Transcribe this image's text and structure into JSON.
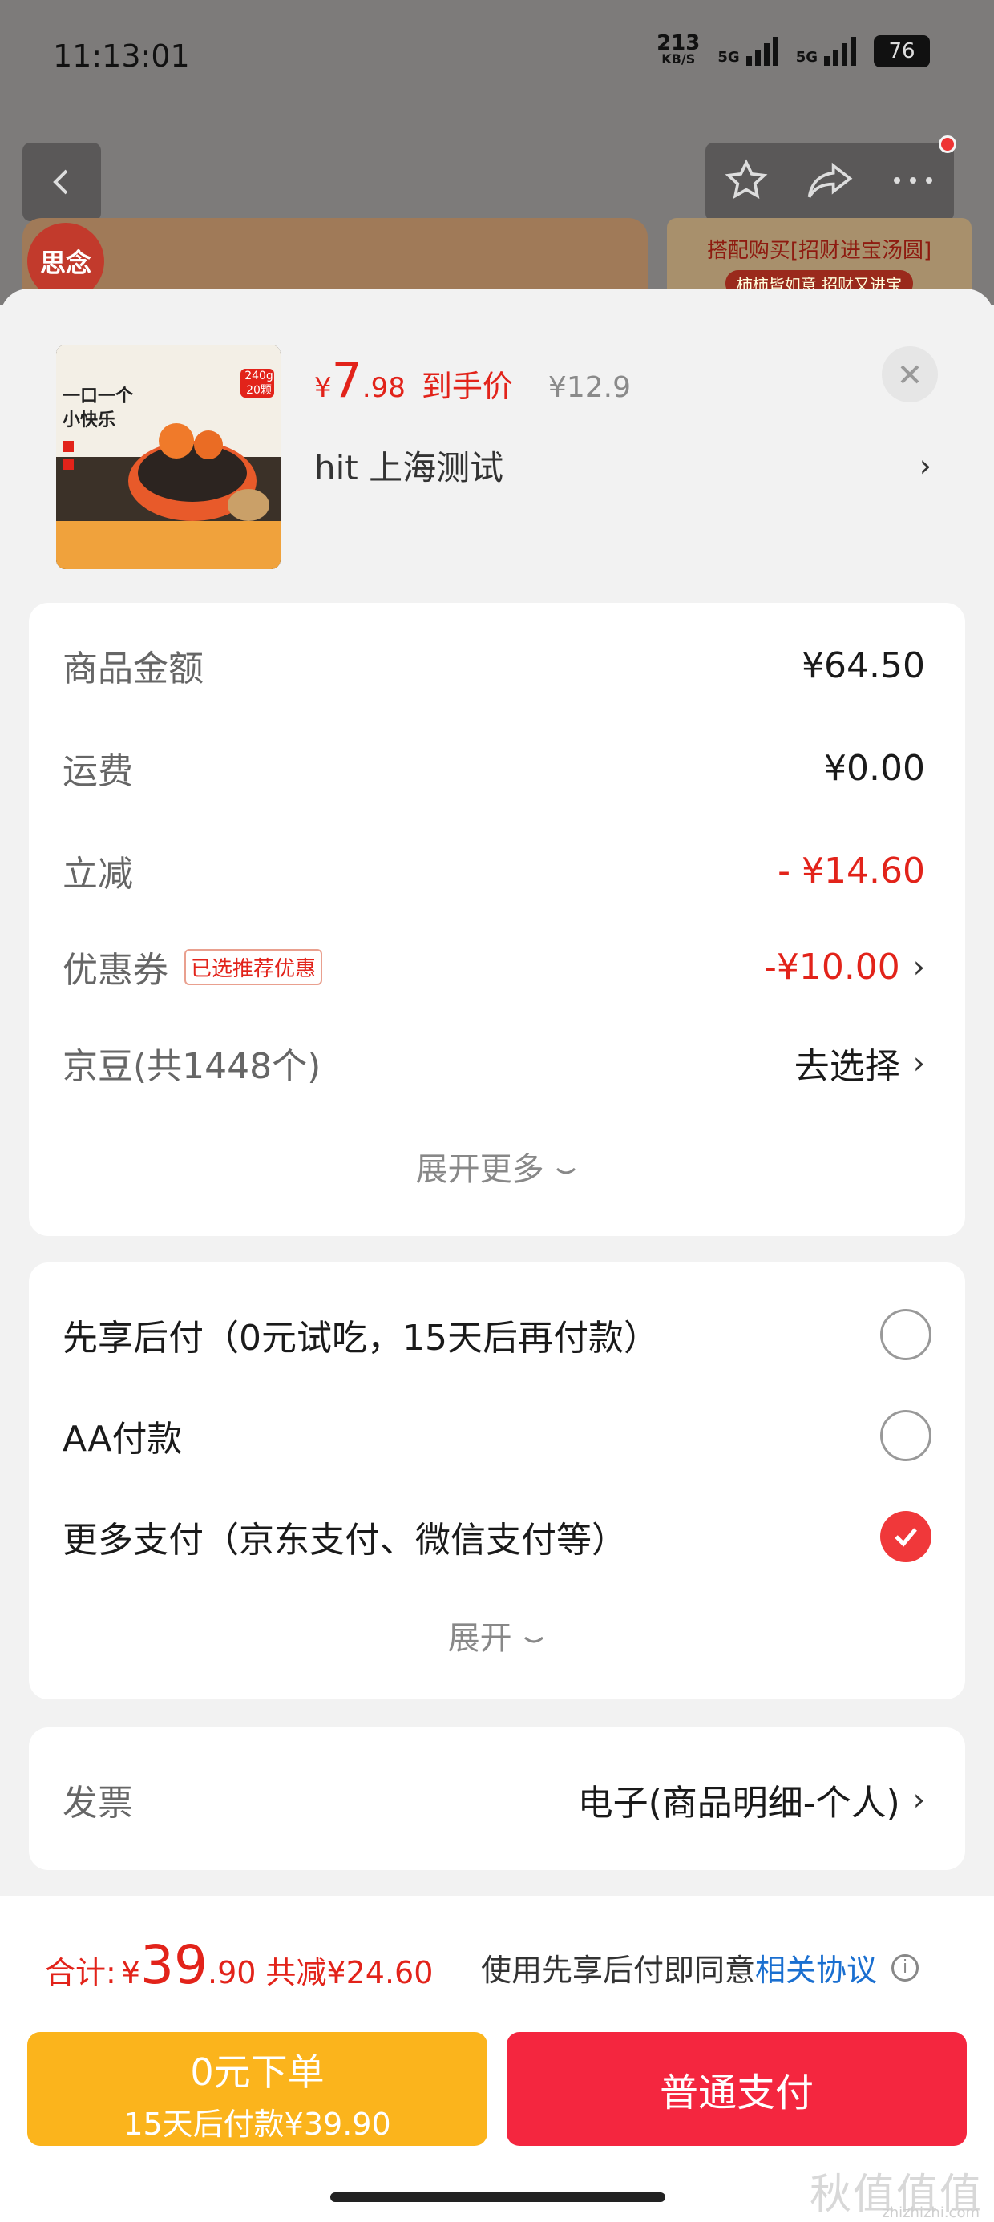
{
  "status_bar": {
    "time": "11:13:01",
    "net_speed": "213",
    "net_unit": "KB/S",
    "signal1": "5G",
    "signal2": "5G",
    "battery": "76"
  },
  "background_page": {
    "brand": "思念",
    "banner_title": "搭配购买[招财进宝汤圆]",
    "banner_sub": "柿柿皆如意 招财又进宝"
  },
  "product": {
    "price_currency": "¥",
    "price_int": "7",
    "price_dec": ".98",
    "price_tag": "到手价",
    "original_price": "¥12.9",
    "address": "hit  上海测试",
    "image_caption": "一口一个 小快乐",
    "image_badge": "240g 20颗"
  },
  "summary": {
    "rows": [
      {
        "label": "商品金额",
        "value": "¥64.50"
      },
      {
        "label": "运费",
        "value": "¥0.00"
      },
      {
        "label": "立减",
        "value": "- ¥14.60"
      },
      {
        "label": "优惠券",
        "value": "-¥10.00",
        "badge": "已选推荐优惠"
      },
      {
        "label": "京豆(共1448个)",
        "value": "去选择"
      }
    ],
    "expand_label": "展开更多"
  },
  "payment": {
    "options": [
      {
        "label": "先享后付（0元试吃，15天后再付款）",
        "selected": false
      },
      {
        "label": "AA付款",
        "selected": false
      },
      {
        "label": "更多支付（京东支付、微信支付等）",
        "selected": true
      }
    ],
    "expand_label": "展开"
  },
  "invoice": {
    "label": "发票",
    "value": "电子(商品明细-个人)"
  },
  "footer": {
    "total_label": "合计:",
    "total_currency": "¥",
    "total_int": "39",
    "total_dec": ".90",
    "saved": "共减¥24.60",
    "agree_text": "使用先享后付即同意",
    "agree_link": "相关协议",
    "bnpl_button": "0元下单",
    "bnpl_sub": "15天后付款¥39.90",
    "pay_button": "普通支付"
  },
  "watermark": {
    "text": "秋值值值",
    "url": "zhizhizhi.com"
  },
  "colors": {
    "accent_red": "#e2231a",
    "bnpl_yellow": "#fbb41c",
    "pay_red": "#f4263f",
    "link_blue": "#1a6fd0"
  }
}
